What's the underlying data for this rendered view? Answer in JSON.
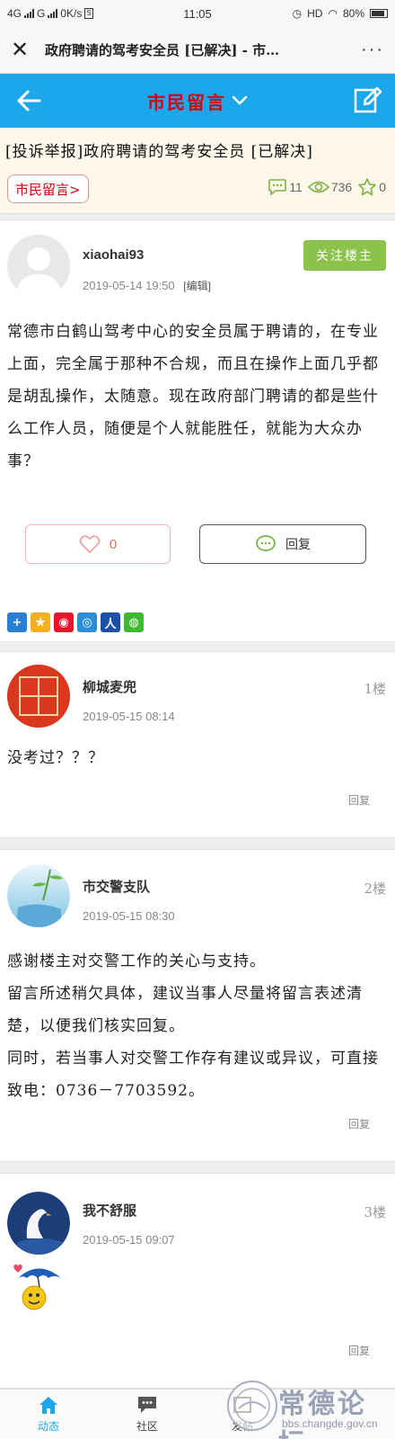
{
  "status_bar": {
    "network1": "4G",
    "network2": "G",
    "speed": "0K/s",
    "time": "11:05",
    "hd": "HD",
    "battery": "80%"
  },
  "title_bar": {
    "title": "政府聘请的驾考安全员 [已解决] - 市…"
  },
  "header": {
    "forum_title": "市民留言"
  },
  "thread": {
    "title": "[投诉举报]政府聘请的驾考安全员 [已解决]",
    "forum_tag": "市民留言>",
    "comments": "11",
    "views": "736",
    "favorites": "0"
  },
  "op": {
    "username": "xiaohai93",
    "date": "2019-05-14 19:50",
    "edit_label": "[编辑]",
    "follow_label": "关注楼主",
    "content": "常德市白鹤山驾考中心的安全员属于聘请的，在专业上面，完全属于那种不合规，而且在操作上面几乎都是胡乱操作，太随意。现在政府部门聘请的都是些什么工作人员，随便是个人就能胜任，就能为大众办事？",
    "like_count": "0",
    "reply_label": "回复"
  },
  "replies": [
    {
      "username": "柳城麦兜",
      "date": "2019-05-15 08:14",
      "floor": "1楼",
      "content": "没考过？？？",
      "reply_label": "回复"
    },
    {
      "username": "市交警支队",
      "date": "2019-05-15 08:30",
      "floor": "2楼",
      "content_lines": [
        "感谢楼主对交警工作的关心与支持。",
        "留言所述稍欠具体，建议当事人尽量将留言表述清楚，以便我们核实回复。",
        "同时，若当事人对交警工作存有建议或异议，可直接致电：0736－7703592。"
      ],
      "reply_label": "回复"
    },
    {
      "username": "我不舒服",
      "date": "2019-05-15 09:07",
      "floor": "3楼",
      "reply_label": "回复"
    }
  ],
  "bottom_nav": {
    "items": [
      "动态",
      "社区",
      "发帖"
    ]
  },
  "watermark": {
    "title": "常德论坛",
    "url": "bbs.changde.gov.cn"
  },
  "colors": {
    "header_blue": "#1ba7ea",
    "title_red": "#d6000f",
    "follow_green": "#8bc34a"
  }
}
